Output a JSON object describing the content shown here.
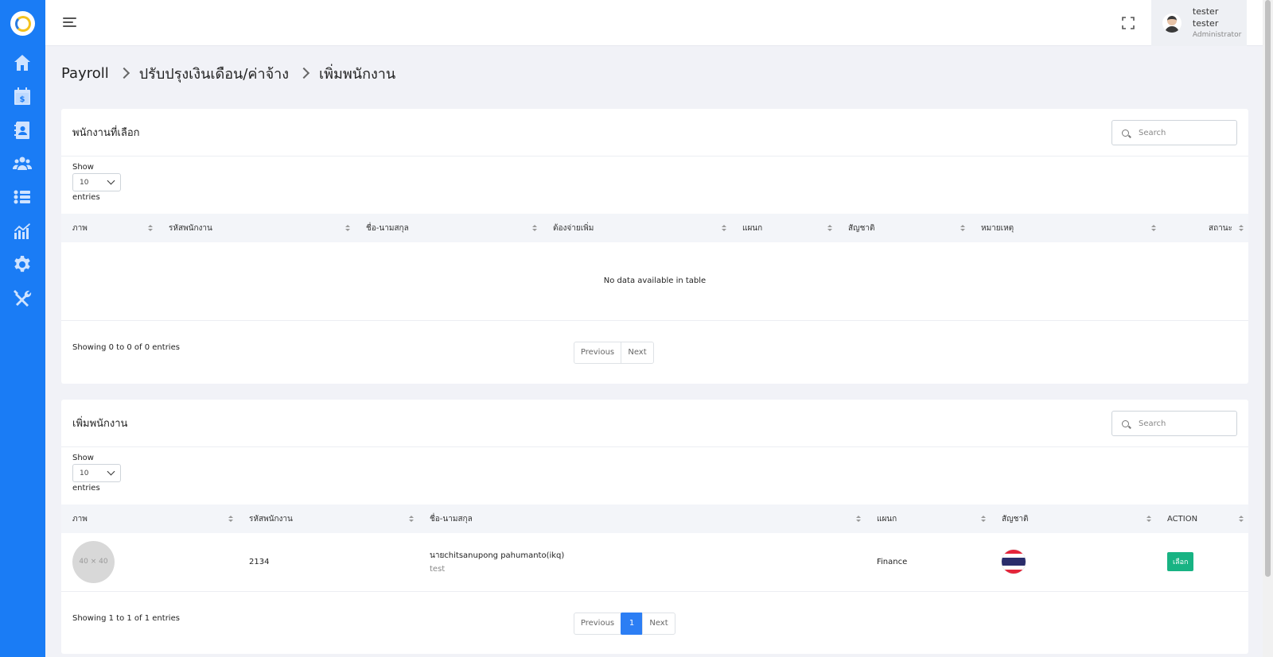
{
  "sidebar": {
    "items": [
      {
        "icon": "home-icon"
      },
      {
        "icon": "payroll-calendar-icon"
      },
      {
        "icon": "contacts-icon"
      },
      {
        "icon": "team-icon"
      },
      {
        "icon": "list-icon"
      },
      {
        "icon": "chart-icon"
      },
      {
        "icon": "gear-icon"
      },
      {
        "icon": "tools-icon"
      }
    ]
  },
  "header": {
    "user_name": "tester tester",
    "user_role": "Administrator"
  },
  "breadcrumb": [
    "Payroll",
    "ปรับปรุงเงินเดือน/ค่าจ้าง",
    "เพิ่มพนักงาน"
  ],
  "selected_card": {
    "title": "พนักงานที่เลือก",
    "search_placeholder": "Search",
    "show_label": "Show",
    "length_value": "10",
    "entries_label": "entries",
    "columns": [
      "ภาพ",
      "รหัสพนักงาน",
      "ชื่อ-นามสกุล",
      "ต้องจ่ายเพิ่ม",
      "แผนก",
      "สัญชาติ",
      "หมายเหตุ",
      "สถานะ"
    ],
    "empty_text": "No data available in table",
    "info": "Showing 0 to 0 of 0 entries",
    "prev": "Previous",
    "next": "Next"
  },
  "add_card": {
    "title": "เพิ่มพนักงาน",
    "search_placeholder": "Search",
    "show_label": "Show",
    "length_value": "10",
    "entries_label": "entries",
    "columns": [
      "ภาพ",
      "รหัสพนักงาน",
      "ชื่อ-นามสกุล",
      "แผนก",
      "สัญชาติ",
      "ACTION"
    ],
    "rows": [
      {
        "photo_placeholder": "40 × 40",
        "code": "2134",
        "name": "นายchitsanupong pahumanto(ikq)",
        "note": "test",
        "department": "Finance",
        "nationality_flag": "thailand-flag",
        "action": "เลือก"
      }
    ],
    "info": "Showing 1 to 1 of 1 entries",
    "prev": "Previous",
    "page": "1",
    "next": "Next"
  },
  "colors": {
    "sidebar": "#1a7cf5",
    "active_page": "#2c7ef4",
    "select_button": "#18b383"
  }
}
